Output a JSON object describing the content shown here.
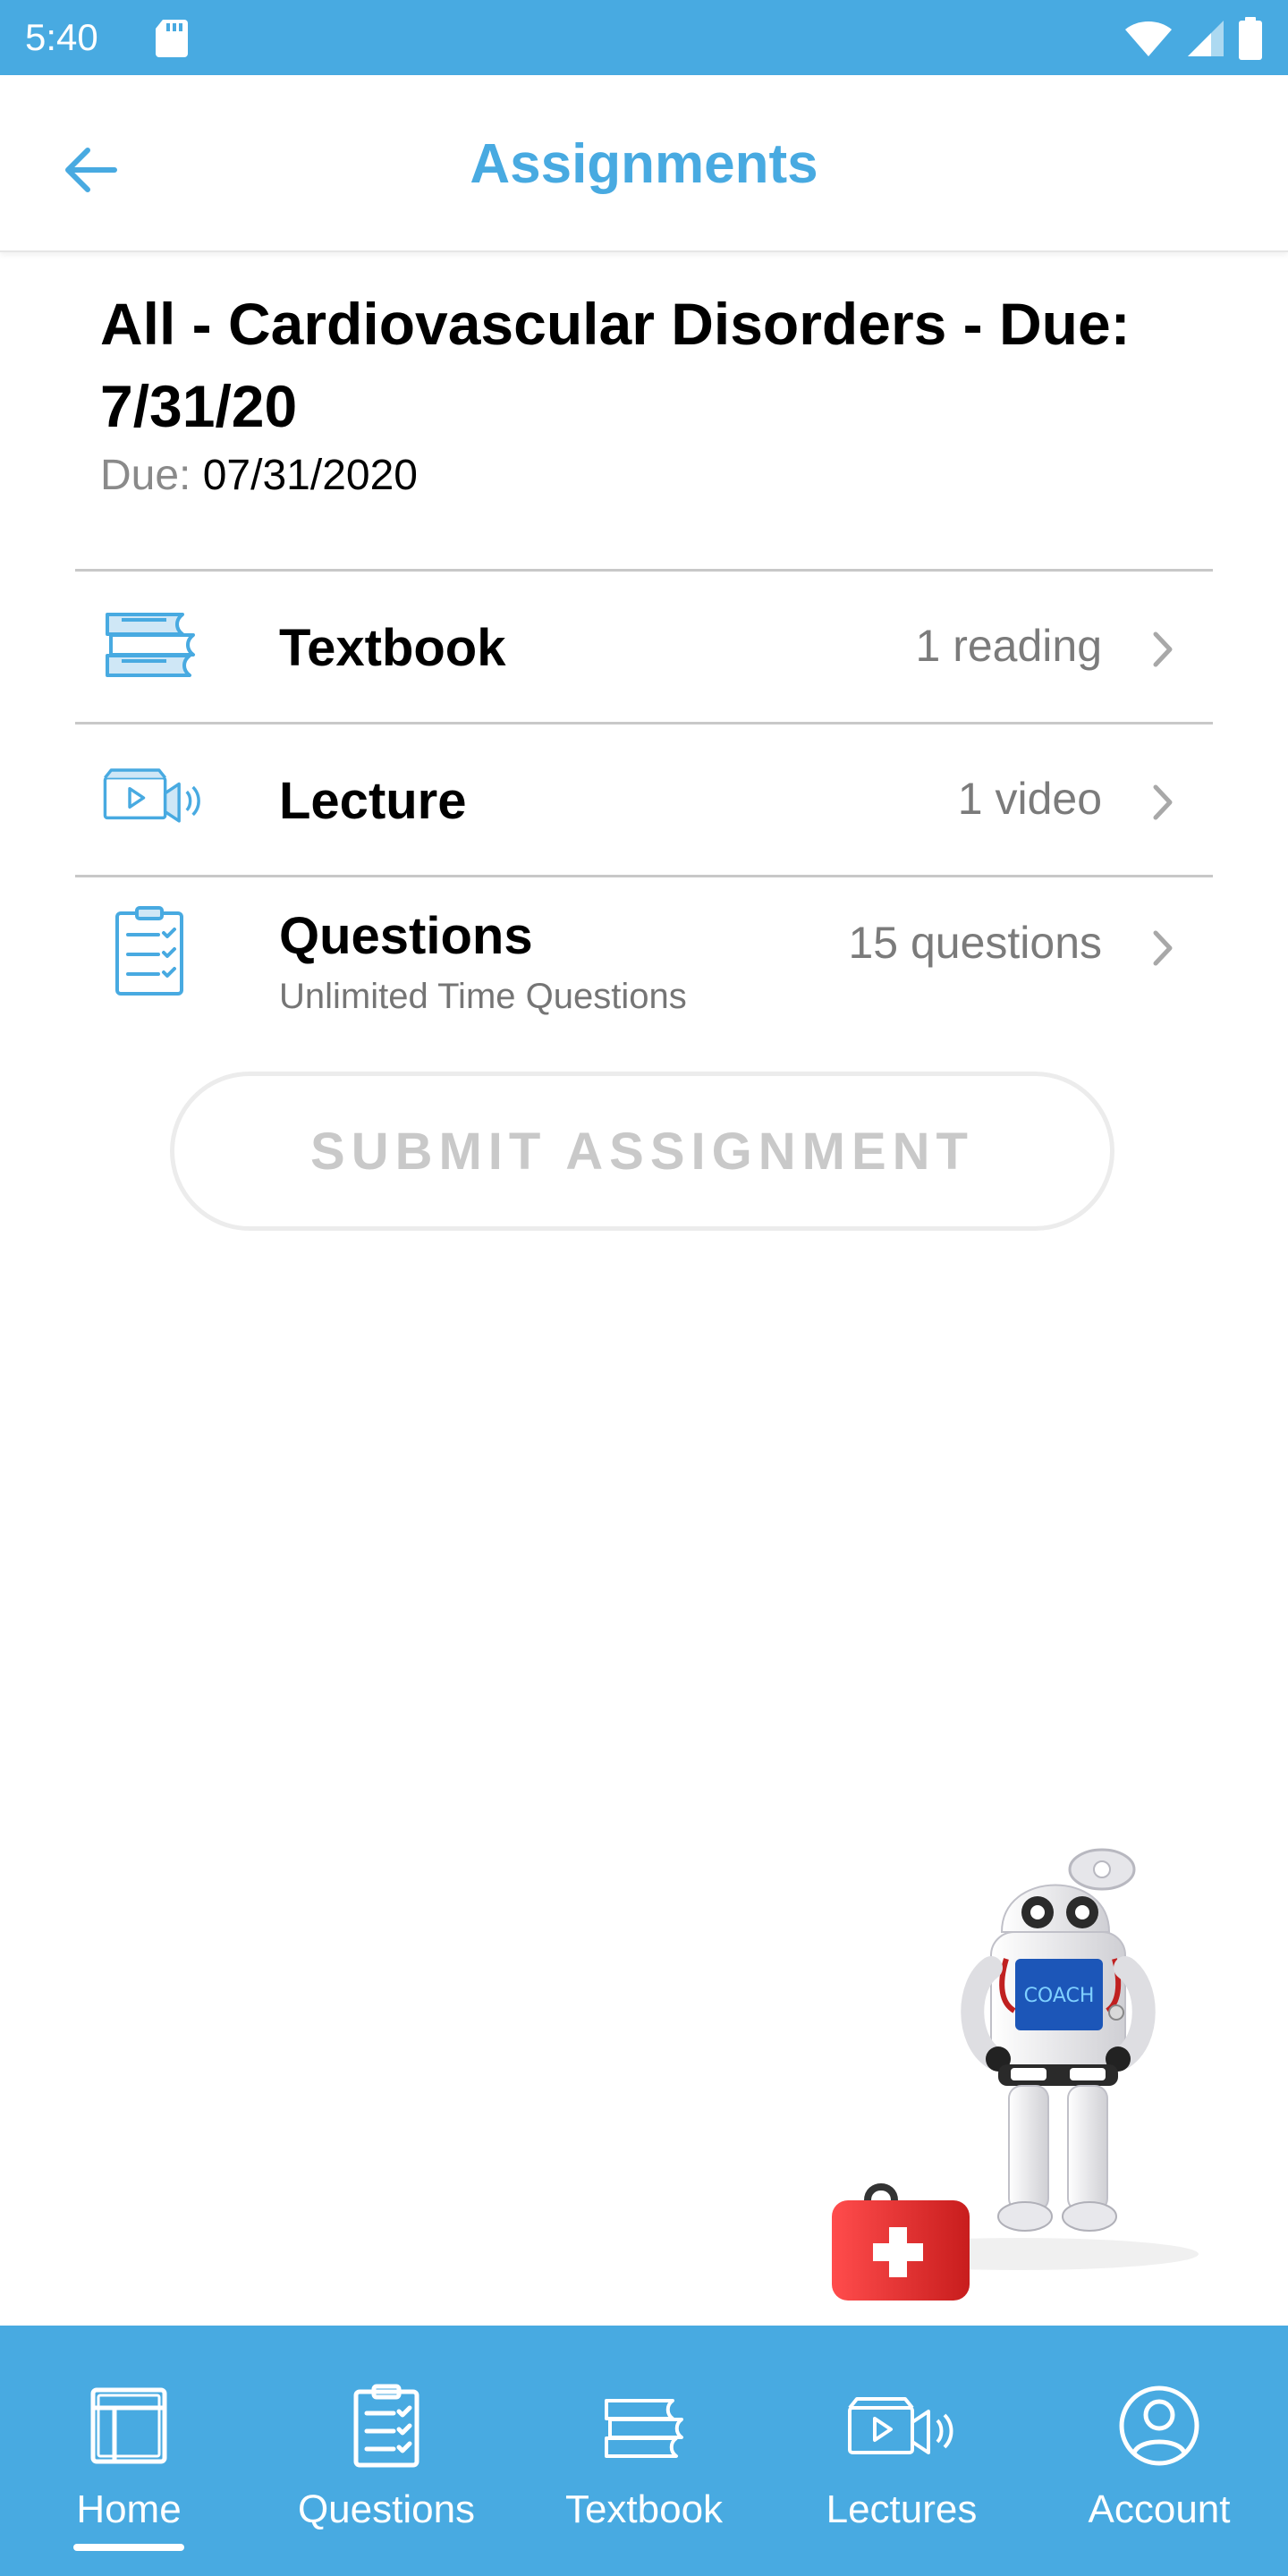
{
  "status_bar": {
    "time": "5:40",
    "icons": [
      "sd-card-icon",
      "wifi-icon",
      "signal-icon",
      "battery-icon"
    ]
  },
  "app_bar": {
    "title": "Assignments",
    "back_icon": "arrow-left-icon"
  },
  "assignment": {
    "title": "All - Cardiovascular Disorders - Due: 7/31/20",
    "due_label": "Due:",
    "due_value": "07/31/2020"
  },
  "items": [
    {
      "label": "Textbook",
      "meta": "1 reading",
      "subtitle": "",
      "icon": "books-icon"
    },
    {
      "label": "Lecture",
      "meta": "1 video",
      "subtitle": "",
      "icon": "video-lecture-icon"
    },
    {
      "label": "Questions",
      "meta": "15 questions",
      "subtitle": "Unlimited Time Questions",
      "icon": "checklist-icon"
    }
  ],
  "submit_label": "SUBMIT ASSIGNMENT",
  "mascot": {
    "screen_text": "COACH"
  },
  "bottom_nav": [
    {
      "label": "Home",
      "icon": "home-icon",
      "active": true
    },
    {
      "label": "Questions",
      "icon": "checklist-icon",
      "active": false
    },
    {
      "label": "Textbook",
      "icon": "books-icon",
      "active": false
    },
    {
      "label": "Lectures",
      "icon": "video-lecture-icon",
      "active": false
    },
    {
      "label": "Account",
      "icon": "account-icon",
      "active": false
    }
  ],
  "colors": {
    "primary": "#48aae1",
    "text": "#000000",
    "muted": "#7b7b7b",
    "divider": "#c8c8c8",
    "disabled": "#c9c9c9"
  }
}
